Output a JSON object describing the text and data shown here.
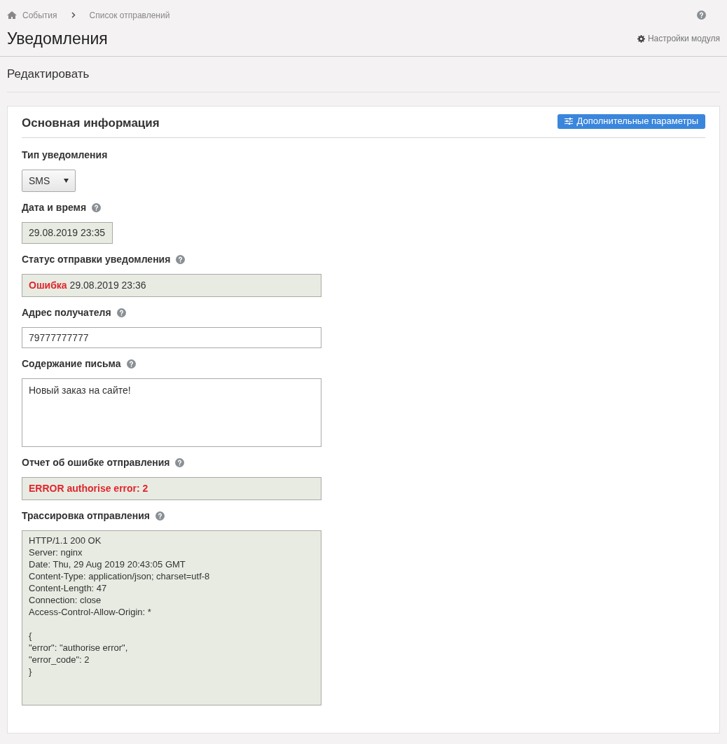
{
  "breadcrumbs": [
    {
      "label": "События",
      "home": true
    },
    {
      "label": "Список отправлений",
      "home": false
    }
  ],
  "page_title": "Уведомления",
  "module_settings": "Настройки модуля",
  "section_title": "Редактировать",
  "card": {
    "title": "Основная информация",
    "extra_button": "Дополнительные параметры"
  },
  "fields": [
    {
      "kind": "select",
      "label": "Тип уведомления",
      "help": false,
      "value": "SMS"
    },
    {
      "kind": "readonly",
      "label": "Дата и время",
      "help": true,
      "value": "29.08.2019 23:35"
    },
    {
      "kind": "status",
      "label": "Статус отправки уведомления",
      "help": true,
      "status": "Ошибка",
      "value": "29.08.2019 23:36"
    },
    {
      "kind": "input",
      "label": "Адрес получателя",
      "help": true,
      "value": "79777777777"
    },
    {
      "kind": "textarea",
      "label": "Содержание письма",
      "help": true,
      "value": "Новый заказ на сайте!"
    },
    {
      "kind": "error",
      "label": "Отчет об ошибке отправления",
      "help": true,
      "value": "ERROR authorise error: 2"
    },
    {
      "kind": "trace",
      "label": "Трассировка отправления",
      "help": true,
      "value": "HTTP/1.1 200 OK\nServer: nginx\nDate: Thu, 29 Aug 2019 20:43:05 GMT\nContent-Type: application/json; charset=utf-8\nContent-Length: 47\nConnection: close\nAccess-Control-Allow-Origin: *\n\n{\n\"error\": \"authorise error\",\n\"error_code\": 2\n}"
    }
  ]
}
